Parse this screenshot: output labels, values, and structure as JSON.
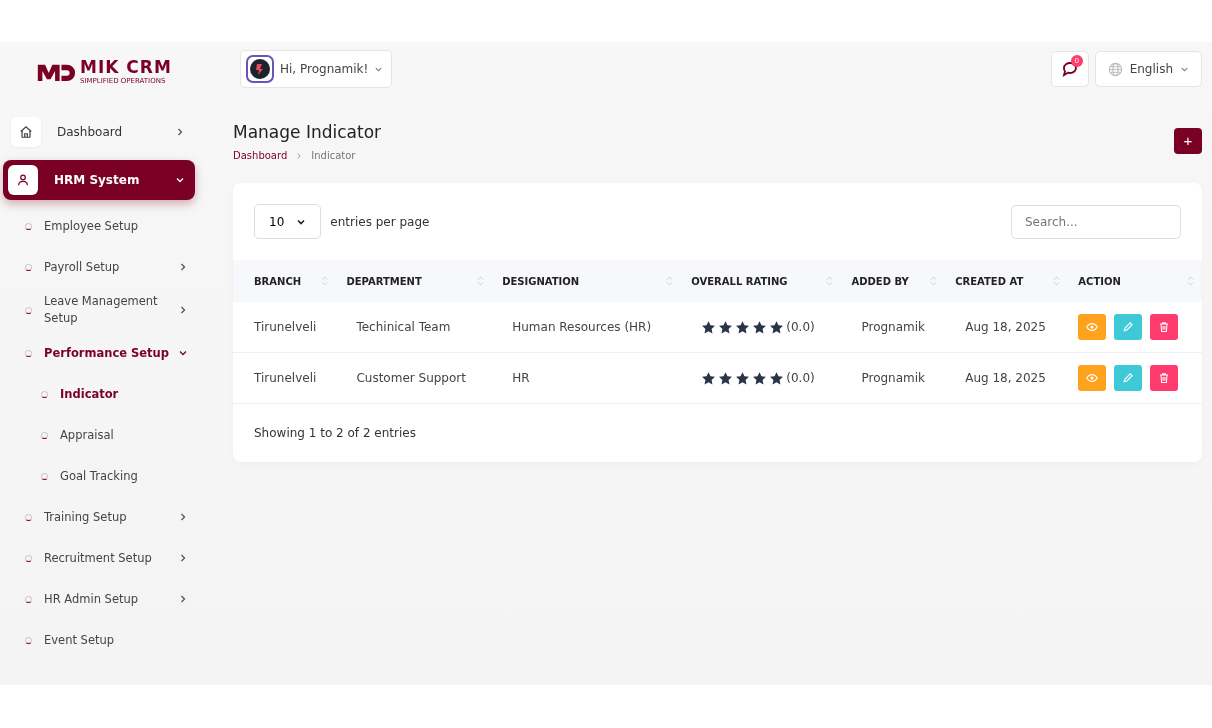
{
  "logo": {
    "name": "MIK CRM",
    "tagline": "SIMPLIFIED OPERATIONS"
  },
  "user_menu": {
    "greeting": "Hi, Prognamik!"
  },
  "notifications": {
    "count": "0"
  },
  "language": {
    "label": "English"
  },
  "sidebar": {
    "items": [
      {
        "label": "Dashboard",
        "selected": false,
        "expanded": false
      },
      {
        "label": "HRM System",
        "selected": true,
        "expanded": true,
        "children": [
          {
            "label": "Employee Setup",
            "selected": false
          },
          {
            "label": "Payroll Setup",
            "selected": false,
            "expanded": false
          },
          {
            "label": "Leave Management Setup",
            "selected": false,
            "expanded": false
          },
          {
            "label": "Performance Setup",
            "selected": true,
            "expanded": true,
            "children": [
              {
                "label": "Indicator",
                "selected": true
              },
              {
                "label": "Appraisal",
                "selected": false
              },
              {
                "label": "Goal Tracking",
                "selected": false
              }
            ]
          },
          {
            "label": "Training Setup",
            "selected": false,
            "expanded": false
          },
          {
            "label": "Recruitment Setup",
            "selected": false,
            "expanded": false
          },
          {
            "label": "HR Admin Setup",
            "selected": false,
            "expanded": false
          },
          {
            "label": "Event Setup",
            "selected": false
          }
        ]
      }
    ]
  },
  "page": {
    "title": "Manage Indicator",
    "breadcrumb": [
      "Dashboard",
      "Indicator"
    ],
    "add_button": "+"
  },
  "table": {
    "per_page": "10",
    "per_page_label": "entries per page",
    "search_placeholder": "Search...",
    "columns": [
      "BRANCH",
      "DEPARTMENT",
      "DESIGNATION",
      "OVERALL RATING",
      "ADDED BY",
      "CREATED AT",
      "ACTION"
    ],
    "rows": [
      {
        "branch": "Tirunelveli",
        "department": "Techinical Team",
        "designation": "Human Resources (HR)",
        "stars": 5,
        "rating": "(0.0)",
        "added_by": "Prognamik",
        "created_at": "Aug 18, 2025"
      },
      {
        "branch": "Tirunelveli",
        "department": "Customer Support",
        "designation": "HR",
        "stars": 5,
        "rating": "(0.0)",
        "added_by": "Prognamik",
        "created_at": "Aug 18, 2025"
      }
    ],
    "footer": "Showing 1 to 2 of 2 entries"
  }
}
